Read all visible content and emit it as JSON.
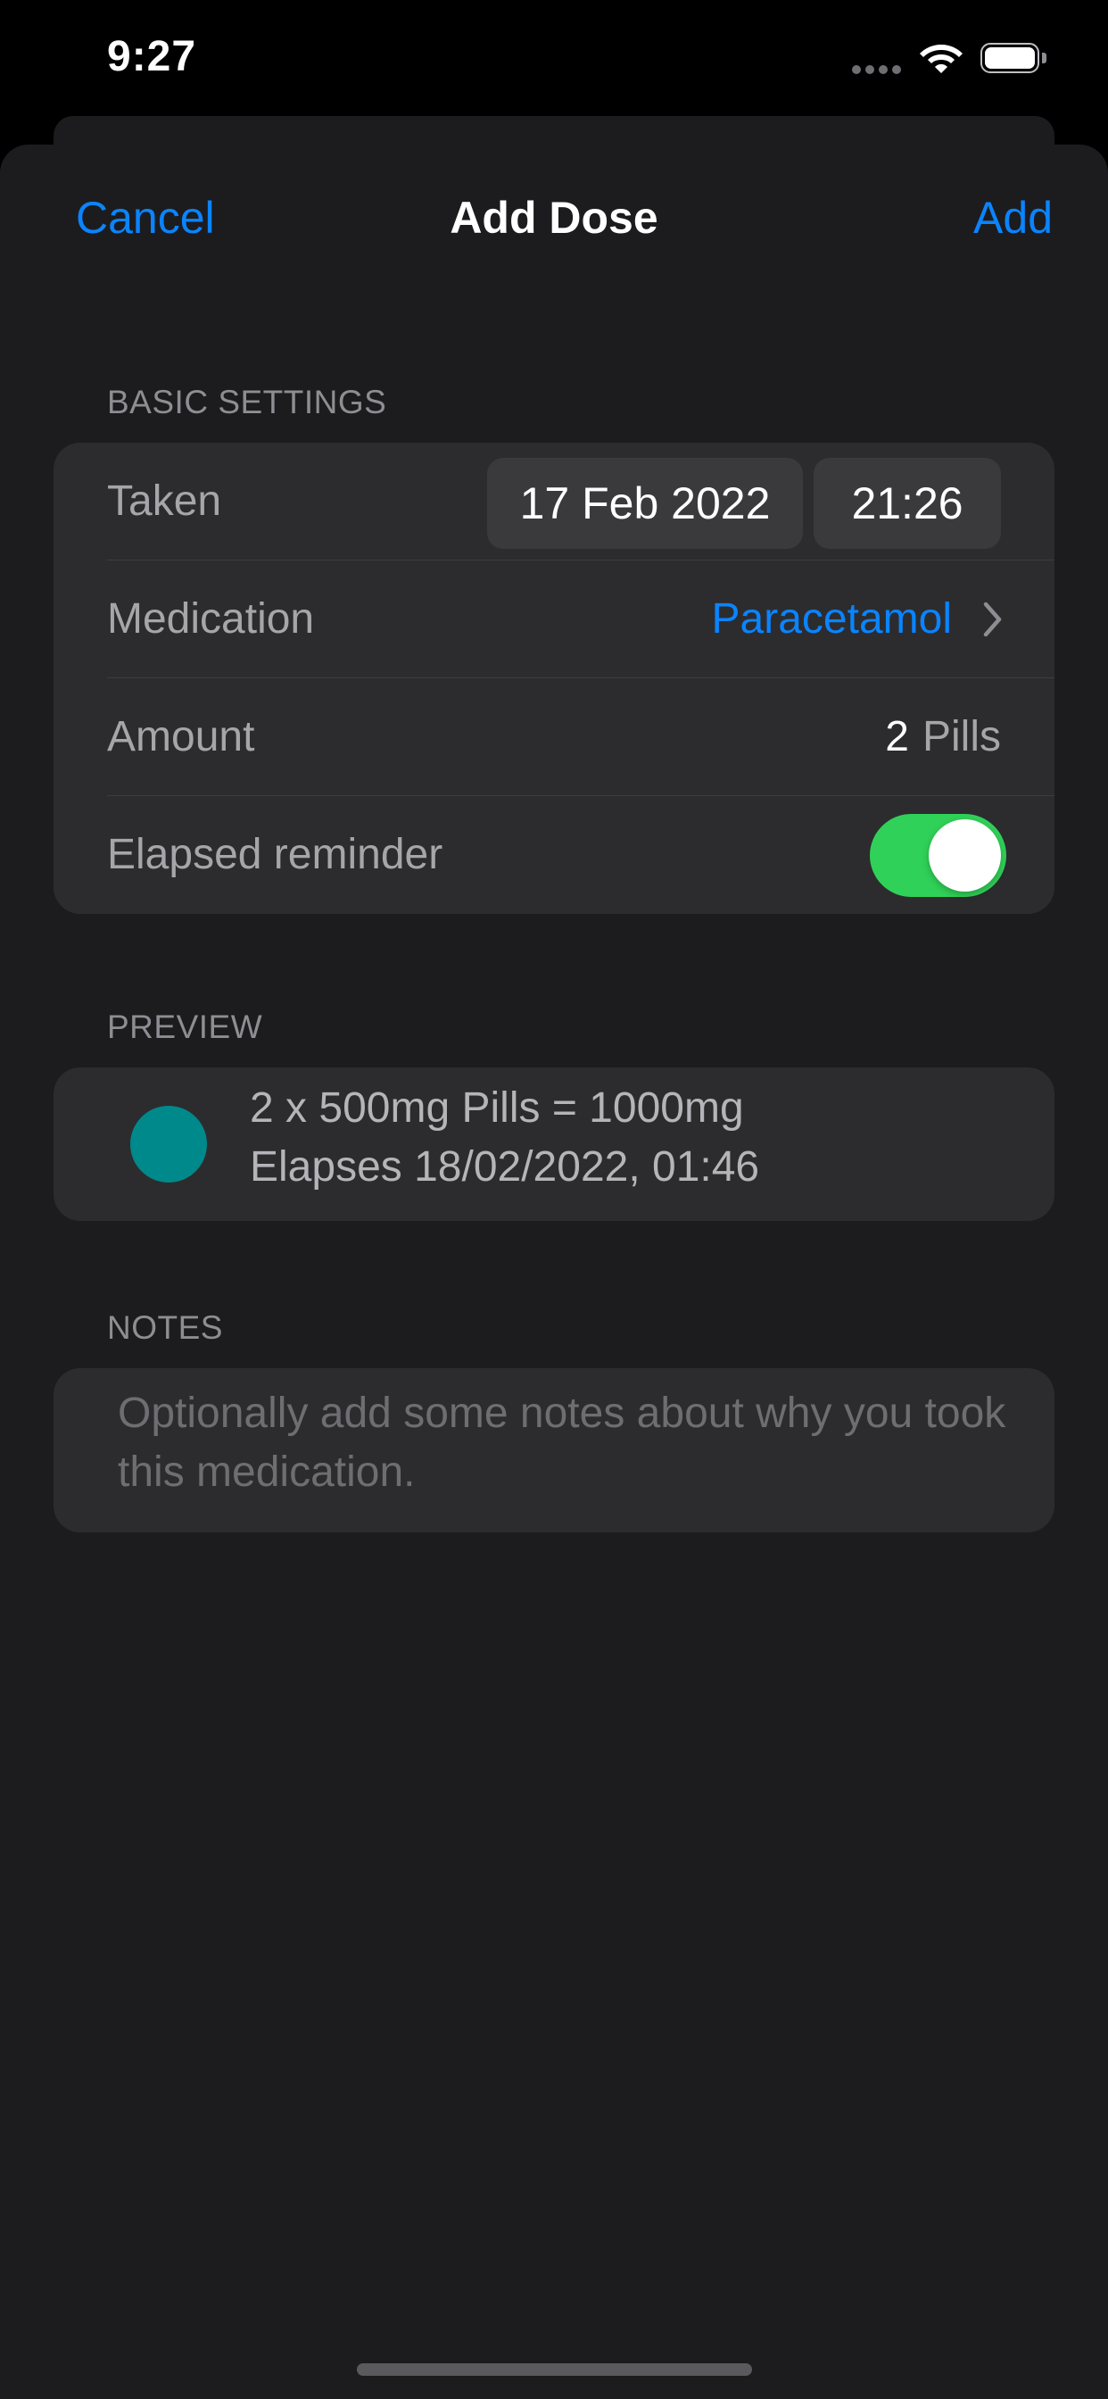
{
  "status_bar": {
    "time": "9:27"
  },
  "nav": {
    "cancel_label": "Cancel",
    "title": "Add Dose",
    "add_label": "Add"
  },
  "basic_settings": {
    "header": "BASIC SETTINGS",
    "taken": {
      "label": "Taken",
      "date": "17 Feb 2022",
      "time": "21:26"
    },
    "medication": {
      "label": "Medication",
      "value": "Paracetamol"
    },
    "amount": {
      "label": "Amount",
      "value": "2",
      "unit": "Pills"
    },
    "elapsed_reminder": {
      "label": "Elapsed reminder",
      "enabled": true
    }
  },
  "preview": {
    "header": "PREVIEW",
    "line1": "2 x 500mg Pills = 1000mg",
    "line2": "Elapses 18/02/2022, 01:46",
    "dot_color": "#00898b"
  },
  "notes": {
    "header": "NOTES",
    "placeholder": "Optionally add some notes about why you took this medication."
  },
  "colors": {
    "accent": "#0a84ff",
    "toggle_on": "#30d158",
    "background": "#1c1c1e",
    "group": "#2c2c2e"
  }
}
